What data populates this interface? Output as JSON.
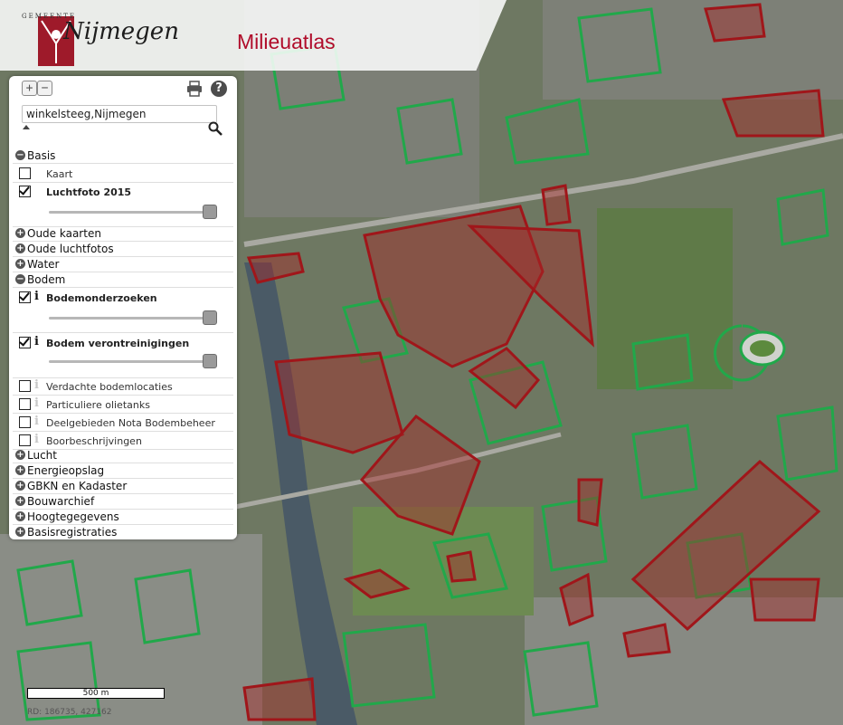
{
  "header": {
    "municipality_small": "GEMEENTE",
    "municipality": "Nijmegen",
    "app_title": "Milieuatlas"
  },
  "toolbar": {
    "zoom_in": "+",
    "zoom_out": "−",
    "help": "?"
  },
  "search": {
    "value": "winkelsteeg,Nijmegen"
  },
  "groups": {
    "basis": {
      "label": "Basis",
      "state": "−"
    },
    "oude_kaarten": {
      "label": "Oude kaarten",
      "state": "+"
    },
    "oude_luchtfotos": {
      "label": "Oude luchtfotos",
      "state": "+"
    },
    "water": {
      "label": "Water",
      "state": "+"
    },
    "bodem": {
      "label": "Bodem",
      "state": "−"
    },
    "lucht": {
      "label": "Lucht",
      "state": "+"
    },
    "energieopslag": {
      "label": "Energieopslag",
      "state": "+"
    },
    "gbkn": {
      "label": "GBKN en Kadaster",
      "state": "+"
    },
    "bouwarchief": {
      "label": "Bouwarchief",
      "state": "+"
    },
    "hoogte": {
      "label": "Hoogtegegevens",
      "state": "+"
    },
    "basisreg": {
      "label": "Basisregistraties",
      "state": "+"
    }
  },
  "layers": {
    "kaart": {
      "label": "Kaart",
      "checked": false
    },
    "luchtfoto": {
      "label": "Luchtfoto 2015",
      "checked": true,
      "opacity": 1.0
    },
    "bodemonderzoeken": {
      "label": "Bodemonderzoeken",
      "checked": true,
      "opacity": 1.0
    },
    "bodemverontreinigingen": {
      "label": "Bodem verontreinigingen",
      "checked": true,
      "opacity": 1.0
    },
    "verdachte": {
      "label": "Verdachte bodemlocaties",
      "checked": false
    },
    "olietanks": {
      "label": "Particuliere olietanks",
      "checked": false
    },
    "deelgebieden": {
      "label": "Deelgebieden Nota Bodembeheer",
      "checked": false
    },
    "boorbeschrijvingen": {
      "label": "Boorbeschrijvingen",
      "checked": false
    }
  },
  "info_glyph": "i",
  "map": {
    "scale_label": "500 m",
    "coords": "RD: 186735, 427162",
    "colors": {
      "base": "#6f7a64",
      "green": "#21a84a",
      "red": "#a0161a",
      "red_fill": "rgba(165,40,40,0.45)",
      "river": "#4a5a66"
    }
  }
}
